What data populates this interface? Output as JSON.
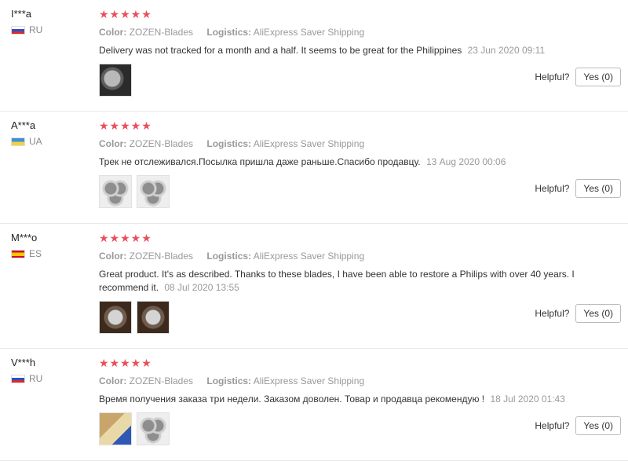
{
  "reviews": [
    {
      "user": "I***a",
      "country": "RU",
      "stars": "★★★★★",
      "color_label": "Color:",
      "color_value": "ZOZEN-Blades",
      "logistics_label": "Logistics:",
      "logistics_value": "AliExpress Saver Shipping",
      "text": "Delivery was not tracked for a month and a half. It seems to be great for the Philippines",
      "date": "23 Jun 2020 09:11",
      "helpful_label": "Helpful?",
      "yes_label": "Yes (0)"
    },
    {
      "user": "A***a",
      "country": "UA",
      "stars": "★★★★★",
      "color_label": "Color:",
      "color_value": "ZOZEN-Blades",
      "logistics_label": "Logistics:",
      "logistics_value": "AliExpress Saver Shipping",
      "text": "Трек не отслеживался.Посылка пришла даже раньше.Спасибо продавцу.",
      "date": "13 Aug 2020 00:06",
      "helpful_label": "Helpful?",
      "yes_label": "Yes (0)"
    },
    {
      "user": "M***o",
      "country": "ES",
      "stars": "★★★★★",
      "color_label": "Color:",
      "color_value": "ZOZEN-Blades",
      "logistics_label": "Logistics:",
      "logistics_value": "AliExpress Saver Shipping",
      "text": "Great product. It's as described. Thanks to these blades, I have been able to restore a Philips with over 40 years. I recommend it.",
      "date": "08 Jul 2020 13:55",
      "helpful_label": "Helpful?",
      "yes_label": "Yes (0)"
    },
    {
      "user": "V***h",
      "country": "RU",
      "stars": "★★★★★",
      "color_label": "Color:",
      "color_value": "ZOZEN-Blades",
      "logistics_label": "Logistics:",
      "logistics_value": "AliExpress Saver Shipping",
      "text": "Время получения заказа три недели. Заказом доволен. Товар и продавца рекомендую !",
      "date": "18 Jul 2020 01:43",
      "helpful_label": "Helpful?",
      "yes_label": "Yes (0)"
    }
  ],
  "colors": {
    "star": "#e8505b",
    "muted_text": "#999999",
    "divider": "#e8e8e8"
  }
}
